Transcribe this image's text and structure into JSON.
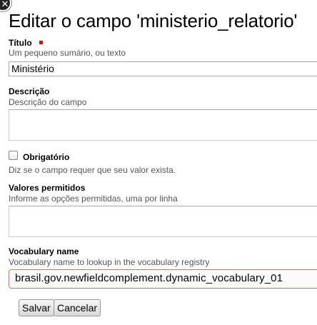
{
  "window": {
    "close_glyph": "✕",
    "close_icon": "close-icon"
  },
  "page": {
    "title": "Editar o campo 'ministerio_relatorio'"
  },
  "fields": {
    "title": {
      "label": "Título",
      "help": "Um pequeno sumário, ou texto",
      "value": "Ministério",
      "required": true,
      "required_color": "#e00000"
    },
    "description": {
      "label": "Descrição",
      "help": "Descrição do campo",
      "value": ""
    },
    "required": {
      "label": "Obrigatório",
      "help": "Diz se o campo requer que seu valor exista.",
      "checked": false
    },
    "allowed_values": {
      "label": "Valores permitidos",
      "help": "Informe as opções permitidas, uma por linha",
      "value": ""
    },
    "vocabulary_name": {
      "label": "Vocabulary name",
      "help": "Vocabulary name to lookup in the vocabulary registry",
      "value": "brasil.gov.newfieldcomplement.dynamic_vocabulary_01",
      "focus_border_color": "#c57b5b"
    }
  },
  "actions": {
    "save_label": "Salvar",
    "cancel_label": "Cancelar"
  }
}
